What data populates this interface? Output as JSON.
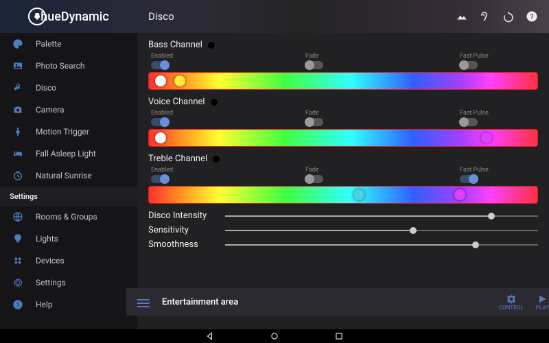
{
  "app_name": "hueDynamic",
  "header": {
    "title": "Disco"
  },
  "sidebar": {
    "items": [
      {
        "label": "Palette",
        "icon": "palette"
      },
      {
        "label": "Photo Search",
        "icon": "photo"
      },
      {
        "label": "Disco",
        "icon": "music"
      },
      {
        "label": "Camera",
        "icon": "camera"
      },
      {
        "label": "Motion Trigger",
        "icon": "motion"
      },
      {
        "label": "Fall Asleep Light",
        "icon": "bed"
      },
      {
        "label": "Natural Sunrise",
        "icon": "clock"
      }
    ],
    "section_header": "Settings",
    "settings": [
      {
        "label": "Rooms & Groups",
        "icon": "globe"
      },
      {
        "label": "Lights",
        "icon": "bulb"
      },
      {
        "label": "Devices",
        "icon": "devices"
      },
      {
        "label": "Settings",
        "icon": "gear"
      },
      {
        "label": "Help",
        "icon": "help"
      }
    ]
  },
  "channels": [
    {
      "name": "Bass Channel",
      "enabled_label": "Enabled",
      "enabled": true,
      "fade_label": "Fade",
      "fade": false,
      "pulse_label": "Fast Pulse",
      "pulse": false,
      "thumbs": [
        {
          "pos": 3,
          "color": ""
        },
        {
          "pos": 8,
          "color": "y"
        }
      ]
    },
    {
      "name": "Voice Channel",
      "enabled_label": "Enabled",
      "enabled": true,
      "fade_label": "Fade",
      "fade": false,
      "pulse_label": "Fast Pulse",
      "pulse": false,
      "thumbs": [
        {
          "pos": 3,
          "color": ""
        },
        {
          "pos": 87,
          "color": "m"
        }
      ]
    },
    {
      "name": "Treble Channel",
      "enabled_label": "Enabled",
      "enabled": true,
      "fade_label": "Fade",
      "fade": false,
      "pulse_label": "Fast Pulse",
      "pulse": true,
      "thumbs": [
        {
          "pos": 54,
          "color": "c"
        },
        {
          "pos": 80,
          "color": "m"
        }
      ]
    }
  ],
  "sliders": [
    {
      "label": "Disco Intensity",
      "value": 85
    },
    {
      "label": "Sensitivity",
      "value": 60
    },
    {
      "label": "Smoothness",
      "value": 80
    }
  ],
  "bottom": {
    "title": "Entertainment area",
    "control_label": "CONTROL",
    "play_label": "PLAY"
  }
}
